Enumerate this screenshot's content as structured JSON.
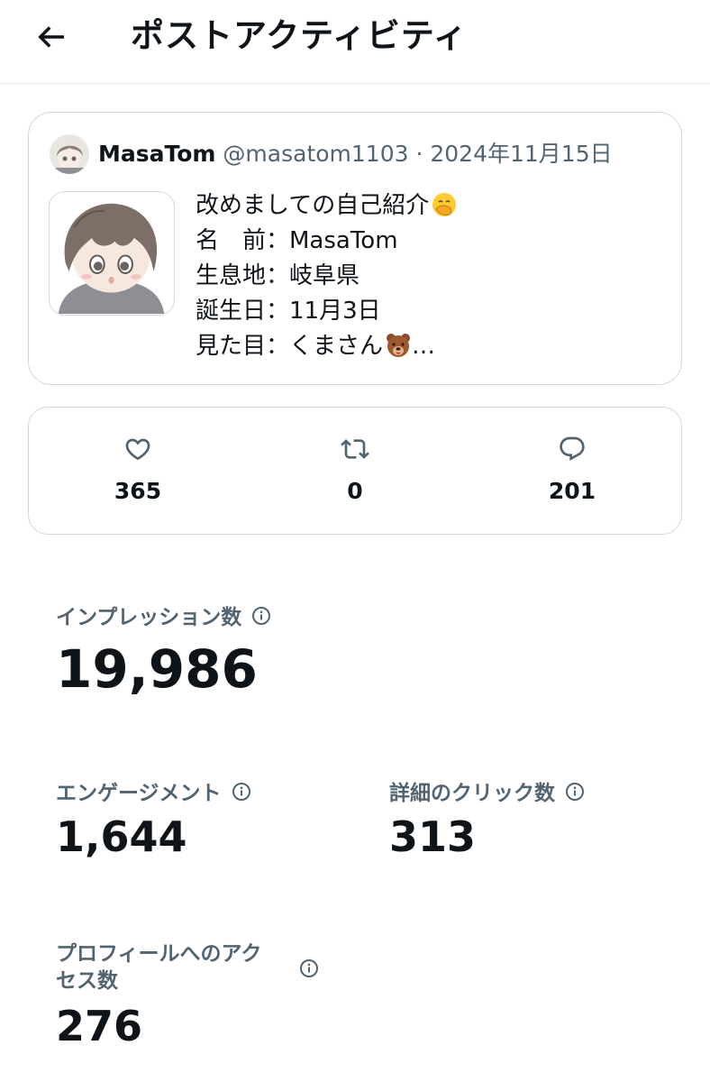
{
  "header": {
    "title": "ポストアクティビティ",
    "back_icon": "arrow-left-icon"
  },
  "post": {
    "author_name": "MasaTom",
    "author_handle": "@masatom1103",
    "separator": "·",
    "date": "2024年11月15日",
    "lines": [
      "改めましての自己紹介",
      "名　前：MasaTom",
      "生息地：岐阜県",
      "誕生日：11月3日",
      "見た目：くまさん"
    ],
    "line1_emoji": "face-with-hand-over-mouth-emoji",
    "line5_emoji": "bear-face-emoji",
    "ellipsis": "…"
  },
  "engagement": {
    "likes": {
      "icon": "heart-icon",
      "value": "365"
    },
    "reposts": {
      "icon": "repost-icon",
      "value": "0"
    },
    "replies": {
      "icon": "reply-icon",
      "value": "201"
    }
  },
  "metrics": {
    "impressions": {
      "label": "インプレッション数",
      "value": "19,986"
    },
    "engagements": {
      "label": "エンゲージメント",
      "value": "1,644"
    },
    "detail_clicks": {
      "label": "詳細のクリック数",
      "value": "313"
    },
    "profile_visits": {
      "label_line1": "プロフィールへのアク",
      "label_line2": "セス数",
      "value": "276"
    }
  },
  "colors": {
    "text": "#0f1419",
    "secondary": "#536471",
    "border": "#d2d8dc"
  }
}
